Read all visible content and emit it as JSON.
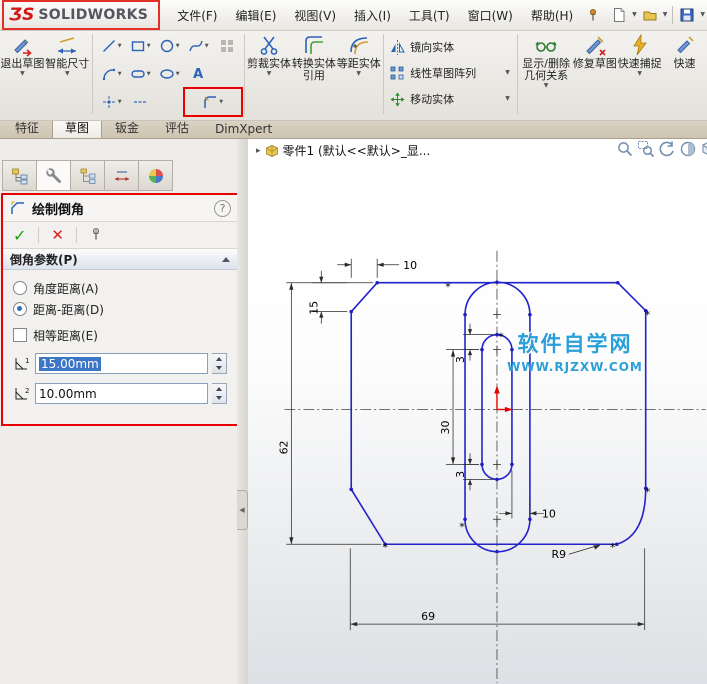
{
  "app": {
    "logo_ds": "ƷS",
    "logo_brand": "SOLIDWORKS",
    "menus": [
      "文件(F)",
      "编辑(E)",
      "视图(V)",
      "插入(I)",
      "工具(T)",
      "窗口(W)",
      "帮助(H)"
    ]
  },
  "toolbar": {
    "exit_sketch": "退出草图",
    "smart_dimension": "智能尺寸",
    "trim": "剪裁实体",
    "convert": "转换实体引用",
    "offset": "等距实体",
    "mirror": "镜向实体",
    "linear_pattern": "线性草图阵列",
    "move": "移动实体",
    "relations": "显示/删除几何关系",
    "repair": "修复草图",
    "quick_snaps": "快速捕捉",
    "quick_partial": "快速"
  },
  "tabs": [
    "特征",
    "草图",
    "钣金",
    "评估",
    "DimXpert"
  ],
  "panel": {
    "title": "绘制倒角",
    "section": "倒角参数(P)",
    "radio_angle": "角度距离(A)",
    "radio_distance": "距离-距离(D)",
    "check_equal": "相等距离(E)",
    "d1_value": "15.00mm",
    "d2_value": "10.00mm",
    "d1_sub": "1",
    "d2_sub": "2"
  },
  "graphics": {
    "tree_title": "零件1 (默认<<默认>_显...",
    "watermark1": "软件自学网",
    "watermark2": "WWW.RJZXW.COM",
    "dims": {
      "chamfer_w": "10",
      "chamfer_h": "15",
      "height": "62",
      "slot_len": "30",
      "gap_top": "3",
      "gap_bottom": "3",
      "slot_gap": "10",
      "width": "69",
      "radius": "R9"
    }
  },
  "icons": {
    "dropdown": "▼",
    "expand": "▸",
    "check": "✓",
    "cancel": "✕",
    "help": "?",
    "collapse_left": "◀",
    "asterisk": "*",
    "textA": "A"
  },
  "colors": {
    "highlight_red": "#ea0000",
    "sketch_blue": "#2323cc",
    "watermark_blue": "#2a9fd8",
    "selection_blue": "#3c76c6"
  }
}
